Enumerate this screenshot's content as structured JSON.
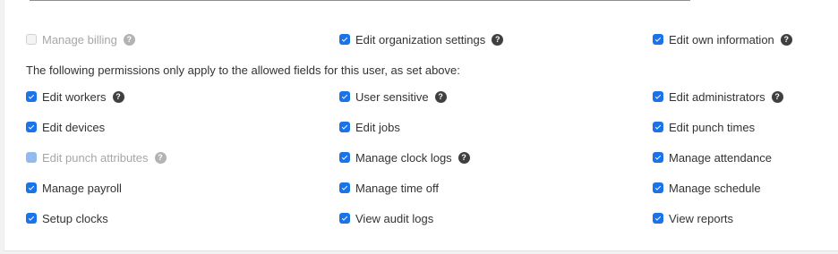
{
  "help_glyph": "?",
  "colors": {
    "checkbox_checked": "#1a73e8",
    "checkbox_disabled": "#93b9ee",
    "help_icon": "#3f3f3f"
  },
  "top_row": [
    {
      "label": "Manage billing",
      "checked": false,
      "disabled": true,
      "help": true
    },
    {
      "label": "Edit organization settings",
      "checked": true,
      "disabled": false,
      "help": true
    },
    {
      "label": "Edit own information",
      "checked": true,
      "disabled": false,
      "help": true
    }
  ],
  "notice": "The following permissions only apply to the allowed fields for this user, as set above:",
  "field_rows": [
    [
      {
        "label": "Edit workers",
        "checked": true,
        "disabled": false,
        "help": true
      },
      {
        "label": "User sensitive",
        "checked": true,
        "disabled": false,
        "help": true
      },
      {
        "label": "Edit administrators",
        "checked": true,
        "disabled": false,
        "help": true
      }
    ],
    [
      {
        "label": "Edit devices",
        "checked": true,
        "disabled": false,
        "help": false
      },
      {
        "label": "Edit jobs",
        "checked": true,
        "disabled": false,
        "help": false
      },
      {
        "label": "Edit punch times",
        "checked": true,
        "disabled": false,
        "help": false
      }
    ],
    [
      {
        "label": "Edit punch attributes",
        "checked": true,
        "disabled": true,
        "help": true
      },
      {
        "label": "Manage clock logs",
        "checked": true,
        "disabled": false,
        "help": true
      },
      {
        "label": "Manage attendance",
        "checked": true,
        "disabled": false,
        "help": false
      }
    ],
    [
      {
        "label": "Manage payroll",
        "checked": true,
        "disabled": false,
        "help": false
      },
      {
        "label": "Manage time off",
        "checked": true,
        "disabled": false,
        "help": false
      },
      {
        "label": "Manage schedule",
        "checked": true,
        "disabled": false,
        "help": false
      }
    ],
    [
      {
        "label": "Setup clocks",
        "checked": true,
        "disabled": false,
        "help": false
      },
      {
        "label": "View audit logs",
        "checked": true,
        "disabled": false,
        "help": false
      },
      {
        "label": "View reports",
        "checked": true,
        "disabled": false,
        "help": false
      }
    ]
  ]
}
